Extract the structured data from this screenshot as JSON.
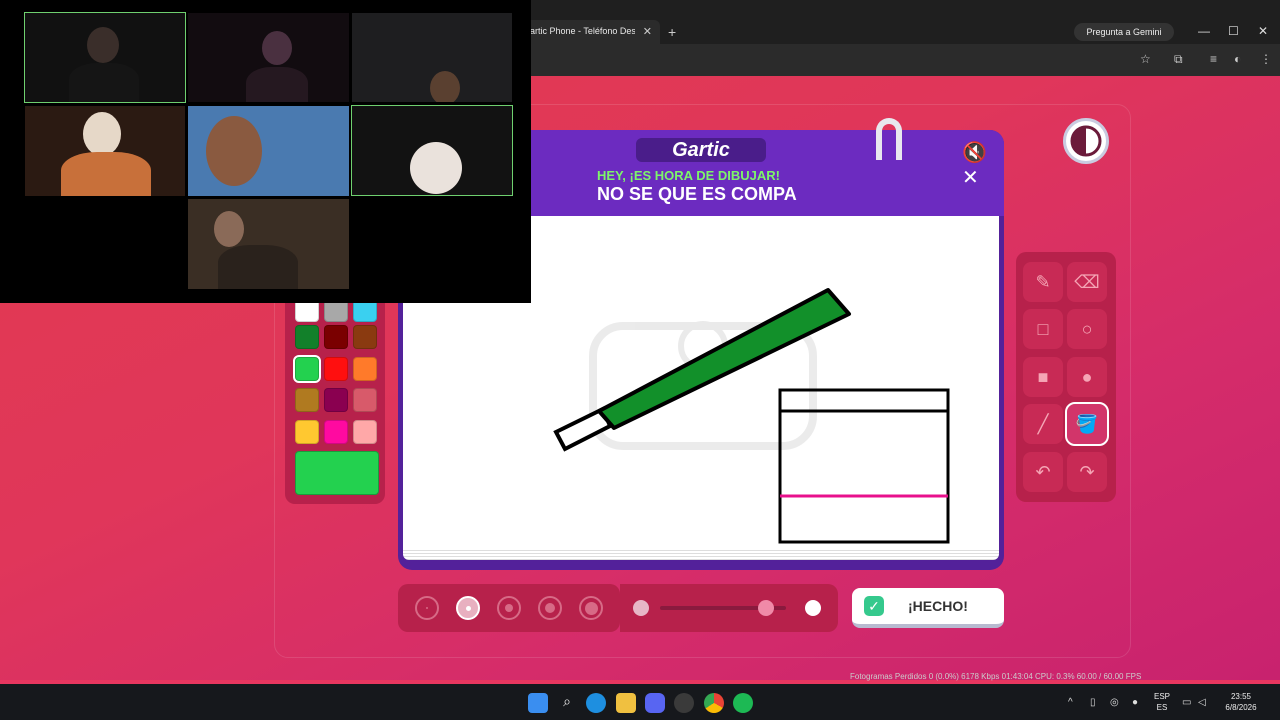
{
  "browser": {
    "tab_title": "artic Phone - Teléfono Descon",
    "tab_close": "✕",
    "new_tab": "+",
    "gemini_label": "Pregunta a Gemini",
    "window_controls": [
      "—",
      "☐",
      "✕"
    ]
  },
  "game": {
    "logo": "Gartic",
    "instruction": "HEY, ¡ES HORA DE DIBUJAR!",
    "prompt": "NO SE QUE ES COMPA",
    "mute_icon": "🔇✕",
    "done_button": "¡HECHO!",
    "colors": {
      "accent": "#6c2bc0",
      "bg": "#e0365a",
      "selected_color": "#23d14f",
      "green_label": "#7df56a"
    },
    "palette": [
      "#ffffff",
      "#a8a8a8",
      "#3ad0f0",
      "#12802a",
      "#7a0000",
      "#8a3a10",
      "#23d14f",
      "#ff0f0f",
      "#ff7a2a",
      "#b07a20",
      "#8a0050",
      "#d85a6a",
      "#ffc830",
      "#ff0aa0",
      "#ffa8a8"
    ],
    "tools": [
      {
        "name": "pencil",
        "icon": "✎"
      },
      {
        "name": "eraser",
        "icon": "⌫"
      },
      {
        "name": "rect-outline",
        "icon": "□"
      },
      {
        "name": "ellipse-outline",
        "icon": "○"
      },
      {
        "name": "rect-fill",
        "icon": "■"
      },
      {
        "name": "ellipse-fill",
        "icon": "●"
      },
      {
        "name": "line",
        "icon": "╱"
      },
      {
        "name": "fill-bucket",
        "icon": "🪣"
      },
      {
        "name": "undo",
        "icon": "↶"
      },
      {
        "name": "redo",
        "icon": "↷"
      }
    ],
    "active_tool_index": 7,
    "brush_size_selected_index": 1,
    "opacity_level": 0.84
  },
  "status_bar": {
    "obs_text": "Fotogramas Perdidos 0 (0.0%)   6178 Kbps   01:43:04           CPU: 0.3%   60.00 / 60.00 FPS"
  },
  "taskbar": {
    "lang_line1": "ESP",
    "lang_line2": "ES",
    "time": "23:55",
    "date": "6/8/2026"
  }
}
